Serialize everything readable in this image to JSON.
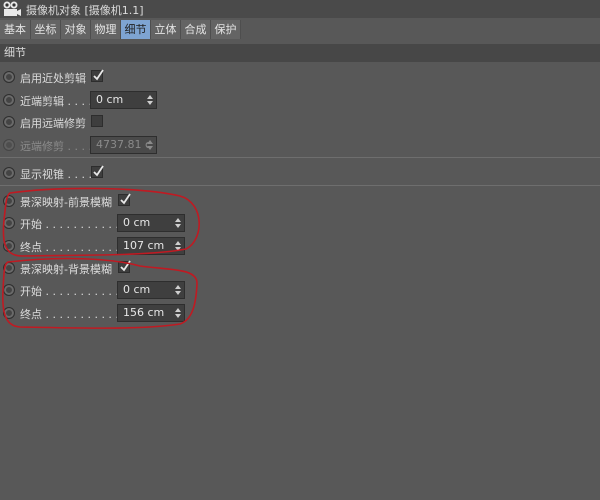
{
  "window": {
    "title": "摄像机对象 [摄像机1.1]"
  },
  "tabs": [
    {
      "label": "基本",
      "active": false
    },
    {
      "label": "坐标",
      "active": false
    },
    {
      "label": "对象",
      "active": false
    },
    {
      "label": "物理",
      "active": false
    },
    {
      "label": "细节",
      "active": true
    },
    {
      "label": "立体",
      "active": false
    },
    {
      "label": "合成",
      "active": false
    },
    {
      "label": "保护",
      "active": false
    }
  ],
  "section": {
    "title": "细节"
  },
  "near_clip": {
    "enable_label": "启用近处剪辑",
    "enable_checked": true,
    "value_label": "近端剪辑 . . . .",
    "value": "0 cm"
  },
  "far_clip": {
    "enable_label": "启用远端修剪",
    "enable_checked": false,
    "value_label": "远端修剪 . . . .",
    "value": "4737.81 c"
  },
  "show_cone": {
    "label": "显示视锥 . . . .",
    "checked": true
  },
  "dof_front": {
    "label": "景深映射-前景模糊",
    "checked": true,
    "start_label": "开始 . . . . . . . . . . . .",
    "start_value": "0 cm",
    "end_label": "终点 . . . . . . . . . . . .",
    "end_value": "107 cm"
  },
  "dof_back": {
    "label": "景深映射-背景模糊",
    "checked": true,
    "start_label": "开始 . . . . . . . . . . . .",
    "start_value": "0 cm",
    "end_label": "终点 . . . . . . . . . . . .",
    "end_value": "156 cm"
  },
  "colors": {
    "background": "#585858",
    "active_tab": "#7ea4d2",
    "annotation": "#c01a22"
  },
  "icons": {
    "camera": "camera-icon",
    "check": "check-icon",
    "spinner": "spinner-icon"
  }
}
